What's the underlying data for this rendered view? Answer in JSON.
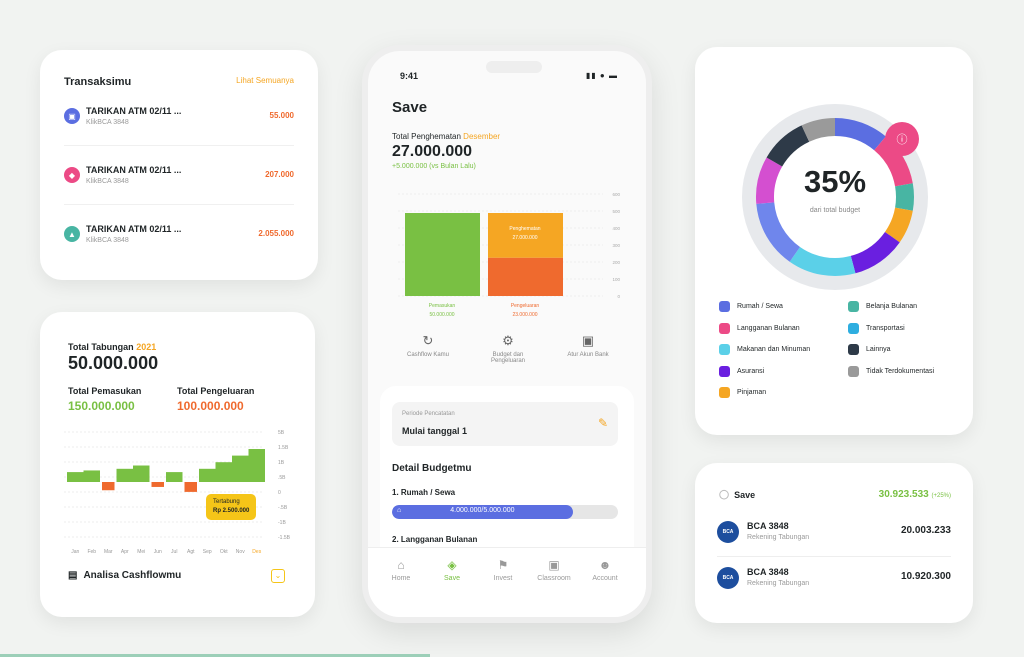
{
  "transactions": {
    "title": "Transaksimu",
    "see_all": "Lihat Semuanya",
    "items": [
      {
        "name": "TARIKAN ATM 02/11 ...",
        "sub": "KlikBCA 3848",
        "amount": "55.000",
        "color": "#5b6ee1",
        "icon": "atm-icon"
      },
      {
        "name": "TARIKAN ATM 02/11 ...",
        "sub": "KlikBCA 3848",
        "amount": "207.000",
        "color": "#ec4a86",
        "icon": "bag-icon"
      },
      {
        "name": "TARIKAN ATM 02/11 ...",
        "sub": "KlikBCA 3848",
        "amount": "2.055.000",
        "color": "#48b5a3",
        "icon": "cart-icon"
      }
    ]
  },
  "savings": {
    "label": "Total Tabungan",
    "year": "2021",
    "total": "50.000.000",
    "income_label": "Total Pemasukan",
    "income": "150.000.000",
    "expense_label": "Total Pengeluaran",
    "expense": "100.000.000",
    "y_ticks": [
      "5B",
      "1.5B",
      "1B",
      ".5B",
      "0",
      "-.5B",
      "-1B",
      "-1.5B"
    ],
    "months": [
      "Jan",
      "Feb",
      "Mar",
      "Apr",
      "Mei",
      "Jun",
      "Jul",
      "Agt",
      "Sep",
      "Okt",
      "Nov",
      "Des"
    ],
    "tooltip_label": "Tertabung",
    "tooltip_value": "Rp 2.500.000",
    "footer": "Analisa Cashflowmu"
  },
  "cashflow_chart": {
    "type": "bar",
    "x": [
      "Jan",
      "Feb",
      "Mar",
      "Apr",
      "Mei",
      "Jun",
      "Jul",
      "Agt",
      "Sep",
      "Okt",
      "Nov",
      "Des"
    ],
    "positive": [
      0.3,
      0.35,
      0,
      0.4,
      0.5,
      0,
      0.3,
      0,
      0.4,
      0.6,
      0.8,
      1.0
    ],
    "negative": [
      0,
      0,
      -0.25,
      0,
      0,
      -0.15,
      0,
      -0.3,
      0,
      0,
      0,
      0
    ],
    "positive_color": "#79c043",
    "negative_color": "#ef6a2e"
  },
  "phone": {
    "time": "9:41",
    "screen_title": "Save",
    "total_label": "Total Penghematan",
    "month": "Desember",
    "total": "27.000.000",
    "delta": "+5.000.000 (vs Bulan Lalu)",
    "chart_ticks": [
      "600",
      "500",
      "400",
      "300",
      "200",
      "100",
      "0"
    ],
    "income_label": "Pemasukan",
    "income_value": "50.000.000",
    "expense_label": "Pengeluaran",
    "expense_value": "23.000.000",
    "saving_label": "Penghematan",
    "saving_value": "27.000.000",
    "actions": [
      {
        "label": "Cashflow Kamu",
        "icon": "cashflow-icon"
      },
      {
        "label": "Budget dan Pengeluaran",
        "icon": "budget-icon"
      },
      {
        "label": "Atur Akun Bank",
        "icon": "bank-icon"
      }
    ],
    "period_label": "Periode Pencatatan",
    "period_value": "Mulai tanggal 1",
    "detail_title": "Detail Budgetmu",
    "budget1_title": "1. Rumah / Sewa",
    "budget1_value": "4.000.000/5.000.000",
    "budget1_progress": 0.8,
    "budget2_title": "2. Langganan Bulanan",
    "tabs": [
      {
        "label": "Home",
        "icon": "home-icon"
      },
      {
        "label": "Save",
        "icon": "save-icon"
      },
      {
        "label": "Invest",
        "icon": "invest-icon"
      },
      {
        "label": "Classroom",
        "icon": "classroom-icon"
      },
      {
        "label": "Account",
        "icon": "account-icon"
      }
    ]
  },
  "phone_bar_chart": {
    "type": "bar",
    "categories": [
      "Pemasukan",
      "Pengeluaran"
    ],
    "income": 50000000,
    "expense": 23000000,
    "saving": 27000000
  },
  "donut": {
    "percent": "35%",
    "caption": "dari total budget",
    "legend": [
      {
        "label": "Rumah / Sewa",
        "color": "#5b6ee1"
      },
      {
        "label": "Belanja Bulanan",
        "color": "#48b5a3"
      },
      {
        "label": "Langganan Bulanan",
        "color": "#ec4a86"
      },
      {
        "label": "Transportasi",
        "color": "#2eaee0"
      },
      {
        "label": "Makanan dan Minuman",
        "color": "#5bd0e8"
      },
      {
        "label": "Lainnya",
        "color": "#2e3a48"
      },
      {
        "label": "Asuransi",
        "color": "#6a1fe0"
      },
      {
        "label": "Tidak Terdokumentasi",
        "color": "#9a9a9a"
      },
      {
        "label": "Pinjaman",
        "color": "#f5a623"
      }
    ]
  },
  "donut_chart": {
    "type": "pie",
    "percent": 35
  },
  "save_card": {
    "title": "Save",
    "total": "30.923.533",
    "change": "(+25%)",
    "accounts": [
      {
        "name": "BCA 3848",
        "sub": "Rekening Tabungan",
        "amount": "20.003.233",
        "logo": "BCA"
      },
      {
        "name": "BCA 3848",
        "sub": "Rekening Tabungan",
        "amount": "10.920.300",
        "logo": "BCA"
      }
    ]
  }
}
